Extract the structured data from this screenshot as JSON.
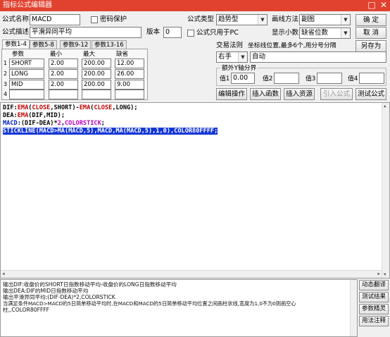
{
  "window": {
    "title": "指标公式编辑器",
    "restore_glyph": "□",
    "close_glyph": "✕"
  },
  "labels": {
    "formula_name": "公式名称",
    "password_protect": "密码保护",
    "formula_desc": "公式描述",
    "version": "版本",
    "formula_type": "公式类型",
    "draw_method": "画线方法",
    "pc_only": "公式只用于PC",
    "decimal_places": "显示小数",
    "trade_rule": "交易法则",
    "coord_hint": "坐标线位置,最多6个,用分号分隔",
    "extra_y_axis": "额外Y轴分界",
    "value1": "值1",
    "value2": "值2",
    "value3": "值3",
    "value4": "值4"
  },
  "fields": {
    "formula_name": "MACD",
    "formula_desc": "平滑异同平均",
    "version": "0",
    "formula_type": "趋势型",
    "draw_method": "副图",
    "decimal_places": "缺省位数",
    "trade_rule_mode": "右手",
    "coord_lines": "自动",
    "value1": "0.00",
    "value2": "",
    "value3": "",
    "value4": ""
  },
  "buttons": {
    "ok": "确  定",
    "cancel": "取  消",
    "save_as": "另存为",
    "edit_ops": "编辑操作",
    "insert_function": "插入函数",
    "insert_resource": "插入资源",
    "import_formula": "引入公式",
    "test_formula": "测试公式",
    "dynamic_translate": "动态翻译",
    "test_result": "测试结果",
    "param_wizard": "参数精灵",
    "usage_notes": "用法注释"
  },
  "tabs": [
    "参数1-4",
    "参数5-8",
    "参数9-12",
    "参数13-16"
  ],
  "params": {
    "headers": [
      "参数",
      "最小",
      "最大",
      "缺省"
    ],
    "rows": [
      {
        "idx": "1",
        "name": "SHORT",
        "min": "2.00",
        "max": "200.00",
        "def": "12.00"
      },
      {
        "idx": "2",
        "name": "LONG",
        "min": "2.00",
        "max": "200.00",
        "def": "26.00"
      },
      {
        "idx": "3",
        "name": "MID",
        "min": "2.00",
        "max": "200.00",
        "def": "9.00"
      },
      {
        "idx": "4",
        "name": "",
        "min": "",
        "max": "",
        "def": ""
      }
    ]
  },
  "code": {
    "l1": [
      "DIF",
      ":",
      "EMA",
      "(",
      "CLOSE",
      ",SHORT)-",
      "EMA",
      "(",
      "CLOSE",
      ",LONG);"
    ],
    "l2": [
      "DEA",
      ":",
      "EMA",
      "(DIF,MID);"
    ],
    "l3": [
      "MACD",
      ":(DIF-DEA)*",
      "2",
      ",",
      "COLORSTICK",
      ";"
    ],
    "l4": "STICKLINE(MACD>MA(MACD,5),MACD,MA(MACD,5),1,0),COLOR80FFFF;"
  },
  "output": [
    "输出DIF:收盘价的SHORT日指数移动平均-收盘价的LONG日指数移动平均",
    "输出DEA:DIF的MID日指数移动平均",
    "输出平滑异同平均:(DIF-DEA)*2,COLORSTICK",
    "当满足条件MACD>MACD的5日简单移动平均时,在MACD和MACD的5日简单移动平均位置之间画柱状线,宽度为1,0不为0则画空心",
    "柱,,COLOR80FFFF"
  ],
  "colors": {
    "titlebar": "#e1422f",
    "code_red": "#c00000",
    "code_blue": "#0020c0",
    "code_pink": "#c000c0",
    "selection": "#1436d6"
  }
}
